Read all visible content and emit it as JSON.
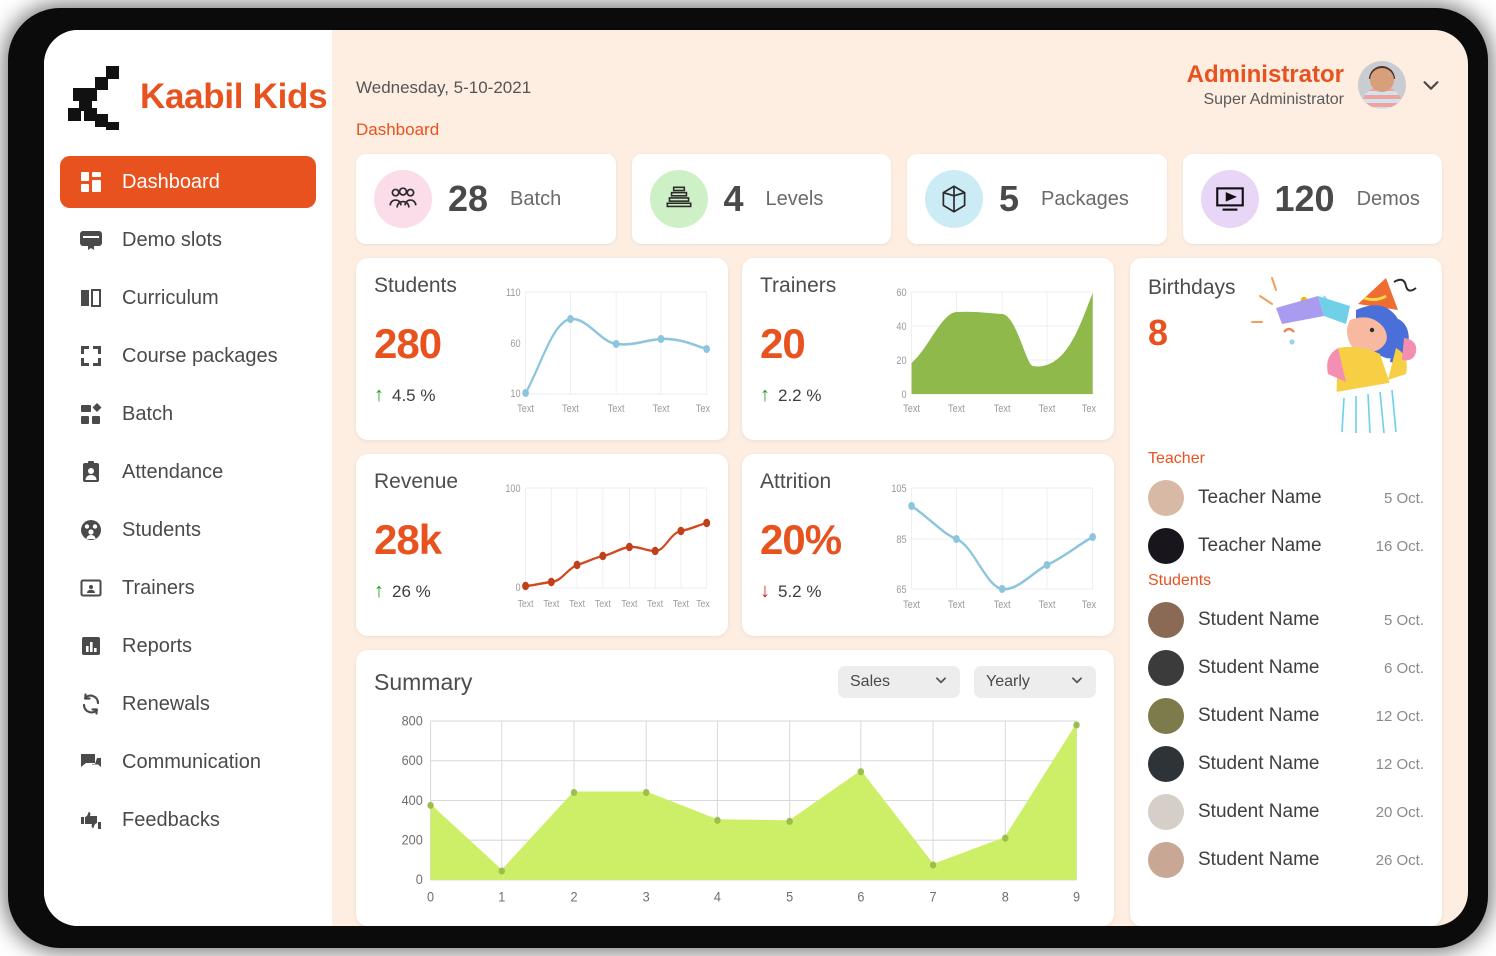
{
  "brand": {
    "name": "Kaabil Kids",
    "logo_icon": "pixel-k-logo"
  },
  "sidebar": {
    "items": [
      {
        "label": "Dashboard",
        "icon": "dashboard-icon",
        "active": true
      },
      {
        "label": "Demo slots",
        "icon": "demo-slots-icon",
        "active": false
      },
      {
        "label": "Curriculum",
        "icon": "book-icon",
        "active": false
      },
      {
        "label": "Course packages",
        "icon": "packages-icon",
        "active": false
      },
      {
        "label": "Batch",
        "icon": "batch-icon",
        "active": false
      },
      {
        "label": "Attendance",
        "icon": "attendance-icon",
        "active": false
      },
      {
        "label": "Students",
        "icon": "students-icon",
        "active": false
      },
      {
        "label": "Trainers",
        "icon": "trainer-card-icon",
        "active": false
      },
      {
        "label": "Reports",
        "icon": "bar-chart-icon",
        "active": false
      },
      {
        "label": "Renewals",
        "icon": "refresh-icon",
        "active": false
      },
      {
        "label": "Communication",
        "icon": "chat-icon",
        "active": false
      },
      {
        "label": "Feedbacks",
        "icon": "thumbs-icon",
        "active": false
      }
    ]
  },
  "header": {
    "date": "Wednesday, 5-10-2021",
    "breadcrumb": "Dashboard",
    "user_name": "Administrator",
    "user_role": "Super Administrator",
    "avatar_icon": "user-avatar",
    "chevron_icon": "chevron-down-icon"
  },
  "kpis": [
    {
      "value": "28",
      "label": "Batch",
      "icon": "group-icon",
      "bg": "#fbdce9",
      "fg": "#2b2b2b"
    },
    {
      "value": "4",
      "label": "Levels",
      "icon": "levels-icon",
      "bg": "#cdf0c6",
      "fg": "#2b2b2b"
    },
    {
      "value": "5",
      "label": "Packages",
      "icon": "cube-icon",
      "bg": "#ccecf5",
      "fg": "#2b2b2b"
    },
    {
      "value": "120",
      "label": "Demos",
      "icon": "video-icon",
      "bg": "#e8d6f7",
      "fg": "#2b2b2b"
    }
  ],
  "stats": [
    {
      "title": "Students",
      "value": "280",
      "delta": "4.5 %",
      "direction": "up",
      "arrow": "arrow-up-icon"
    },
    {
      "title": "Trainers",
      "value": "20",
      "delta": "2.2 %",
      "direction": "up",
      "arrow": "arrow-up-icon"
    },
    {
      "title": "Revenue",
      "value": "28k",
      "delta": "26 %",
      "direction": "up",
      "arrow": "arrow-up-icon"
    },
    {
      "title": "Attrition",
      "value": "20%",
      "delta": "5.2 %",
      "direction": "down",
      "arrow": "arrow-down-icon"
    }
  ],
  "summary": {
    "title": "Summary",
    "metric_select": "Sales",
    "period_select": "Yearly",
    "chevron_icon": "chevron-down-icon"
  },
  "birthdays": {
    "title": "Birthdays",
    "count": "8",
    "illustration_icon": "party-celebration-illustration",
    "teacher_group_label": "Teacher",
    "students_group_label": "Students",
    "teachers": [
      {
        "name": "Teacher Name",
        "date": "5 Oct.",
        "avatar_bg": "#d8b9a6"
      },
      {
        "name": "Teacher Name",
        "date": "16 Oct.",
        "avatar_bg": "#18151c"
      }
    ],
    "students": [
      {
        "name": "Student Name",
        "date": "5 Oct.",
        "avatar_bg": "#8a6a54"
      },
      {
        "name": "Student Name",
        "date": "6 Oct.",
        "avatar_bg": "#3b3b3b"
      },
      {
        "name": "Student Name",
        "date": "12 Oct.",
        "avatar_bg": "#7d7a4c"
      },
      {
        "name": "Student Name",
        "date": "12 Oct.",
        "avatar_bg": "#2e3338"
      },
      {
        "name": "Student Name",
        "date": "20 Oct.",
        "avatar_bg": "#d6cfc8"
      },
      {
        "name": "Student Name",
        "date": "26 Oct.",
        "avatar_bg": "#c8a894"
      }
    ]
  },
  "colors": {
    "accent_orange": "#e8521f",
    "page_bg": "#fdeee1",
    "card_bg": "#ffffff",
    "up_green": "#18a018",
    "down_red": "#e01b1b",
    "line_blue": "#8ec5de",
    "area_green": "#8fb94a",
    "line_red": "#d4481f",
    "summary_green": "#cdef68"
  },
  "chart_data": [
    {
      "id": "students",
      "type": "line",
      "title": "Students",
      "categories": [
        "Text",
        "Text",
        "Text",
        "Text",
        "Text"
      ],
      "values": [
        11,
        85,
        62,
        66,
        57
      ],
      "yticks": [
        10,
        60,
        110
      ],
      "ylim": [
        10,
        110
      ],
      "color": "#8ec5de",
      "markers": true,
      "grid": true,
      "legend": "none"
    },
    {
      "id": "trainers",
      "type": "area",
      "title": "Trainers",
      "categories": [
        "Text",
        "Text",
        "Text",
        "Text",
        "Text"
      ],
      "values": [
        18,
        48,
        47,
        17,
        59
      ],
      "yticks": [
        0,
        20,
        40,
        60
      ],
      "ylim": [
        0,
        60
      ],
      "color": "#8fb94a",
      "markers": false,
      "grid": true,
      "legend": "none"
    },
    {
      "id": "revenue",
      "type": "line",
      "title": "Revenue",
      "categories": [
        "Text",
        "Text",
        "Text",
        "Text",
        "Text",
        "Text",
        "Text",
        "Text"
      ],
      "values": [
        2,
        6,
        20,
        27,
        37,
        34,
        52,
        58
      ],
      "yticks": [
        0,
        100
      ],
      "ylim": [
        0,
        100
      ],
      "color": "#d4481f",
      "markers": true,
      "grid": true,
      "legend": "none"
    },
    {
      "id": "attrition",
      "type": "line",
      "title": "Attrition",
      "categories": [
        "Text",
        "Text",
        "Text",
        "Text",
        "Text"
      ],
      "values": [
        98,
        85,
        65,
        73,
        88
      ],
      "yticks": [
        65,
        85,
        105
      ],
      "ylim": [
        65,
        105
      ],
      "color": "#8ec5de",
      "markers": true,
      "grid": true,
      "legend": "none"
    },
    {
      "id": "summary",
      "type": "area",
      "title": "Summary",
      "x": [
        0,
        1,
        2,
        3,
        4,
        5,
        6,
        7,
        8,
        9
      ],
      "categories": [
        "0",
        "1",
        "2",
        "3",
        "4",
        "5",
        "6",
        "7",
        "8",
        "9"
      ],
      "values": [
        375,
        45,
        440,
        440,
        300,
        295,
        545,
        75,
        210,
        780
      ],
      "yticks": [
        0,
        200,
        400,
        600,
        800
      ],
      "ylim": [
        0,
        800
      ],
      "xlim": [
        0,
        9
      ],
      "xlabel": "",
      "ylabel": "",
      "color": "#cdef68",
      "markers": true,
      "grid": true,
      "legend": "none"
    }
  ]
}
